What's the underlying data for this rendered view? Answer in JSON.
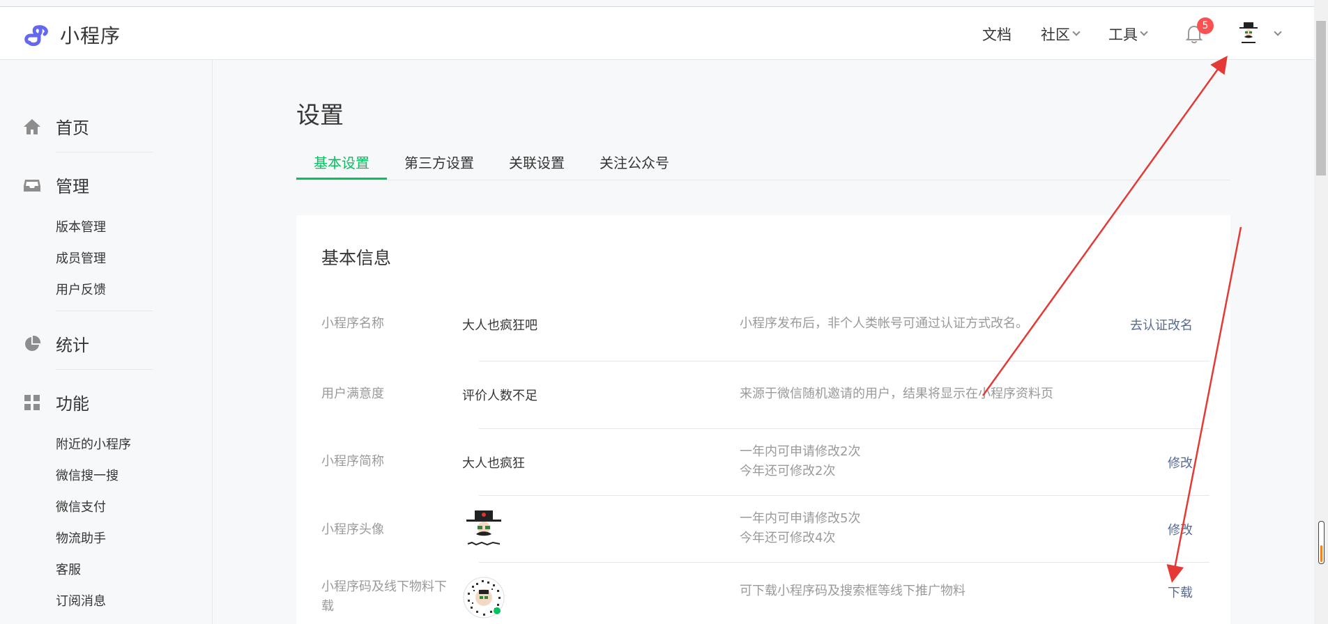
{
  "header": {
    "logo_text": "小程序",
    "nav": {
      "docs": "文档",
      "community": "社区",
      "tools": "工具"
    },
    "notification_count": "5"
  },
  "sidebar": {
    "home": "首页",
    "manage": "管理",
    "manage_items": [
      "版本管理",
      "成员管理",
      "用户反馈"
    ],
    "stats": "统计",
    "features": "功能",
    "feature_items": [
      "附近的小程序",
      "微信搜一搜",
      "微信支付",
      "物流助手",
      "客服",
      "订阅消息"
    ]
  },
  "page": {
    "title": "设置",
    "tabs": [
      "基本设置",
      "第三方设置",
      "关联设置",
      "关注公众号"
    ],
    "active_tab": 0
  },
  "basic_info": {
    "title": "基本信息",
    "rows": [
      {
        "label": "小程序名称",
        "value": "大人也疯狂吧",
        "tip": "小程序发布后，非个人类帐号可通过认证方式改名。",
        "action": "去认证改名"
      },
      {
        "label": "用户满意度",
        "value": "评价人数不足",
        "tip": "来源于微信随机邀请的用户，结果将显示在小程序资料页",
        "action": ""
      },
      {
        "label": "小程序简称",
        "value": "大人也疯狂",
        "tip_line1": "一年内可申请修改2次",
        "tip_line2": "今年还可修改2次",
        "action": "修改"
      },
      {
        "label": "小程序头像",
        "tip_line1": "一年内可申请修改5次",
        "tip_line2": "今年还可修改4次",
        "action": "修改"
      },
      {
        "label": "小程序码及线下物料下载",
        "tip": "可下载小程序码及搜索框等线下推广物料",
        "action": "下载"
      }
    ]
  },
  "colors": {
    "accent_green": "#07c160",
    "link_blue": "#576b95",
    "badge_red": "#fa5151",
    "annotation_red": "#e53935"
  }
}
